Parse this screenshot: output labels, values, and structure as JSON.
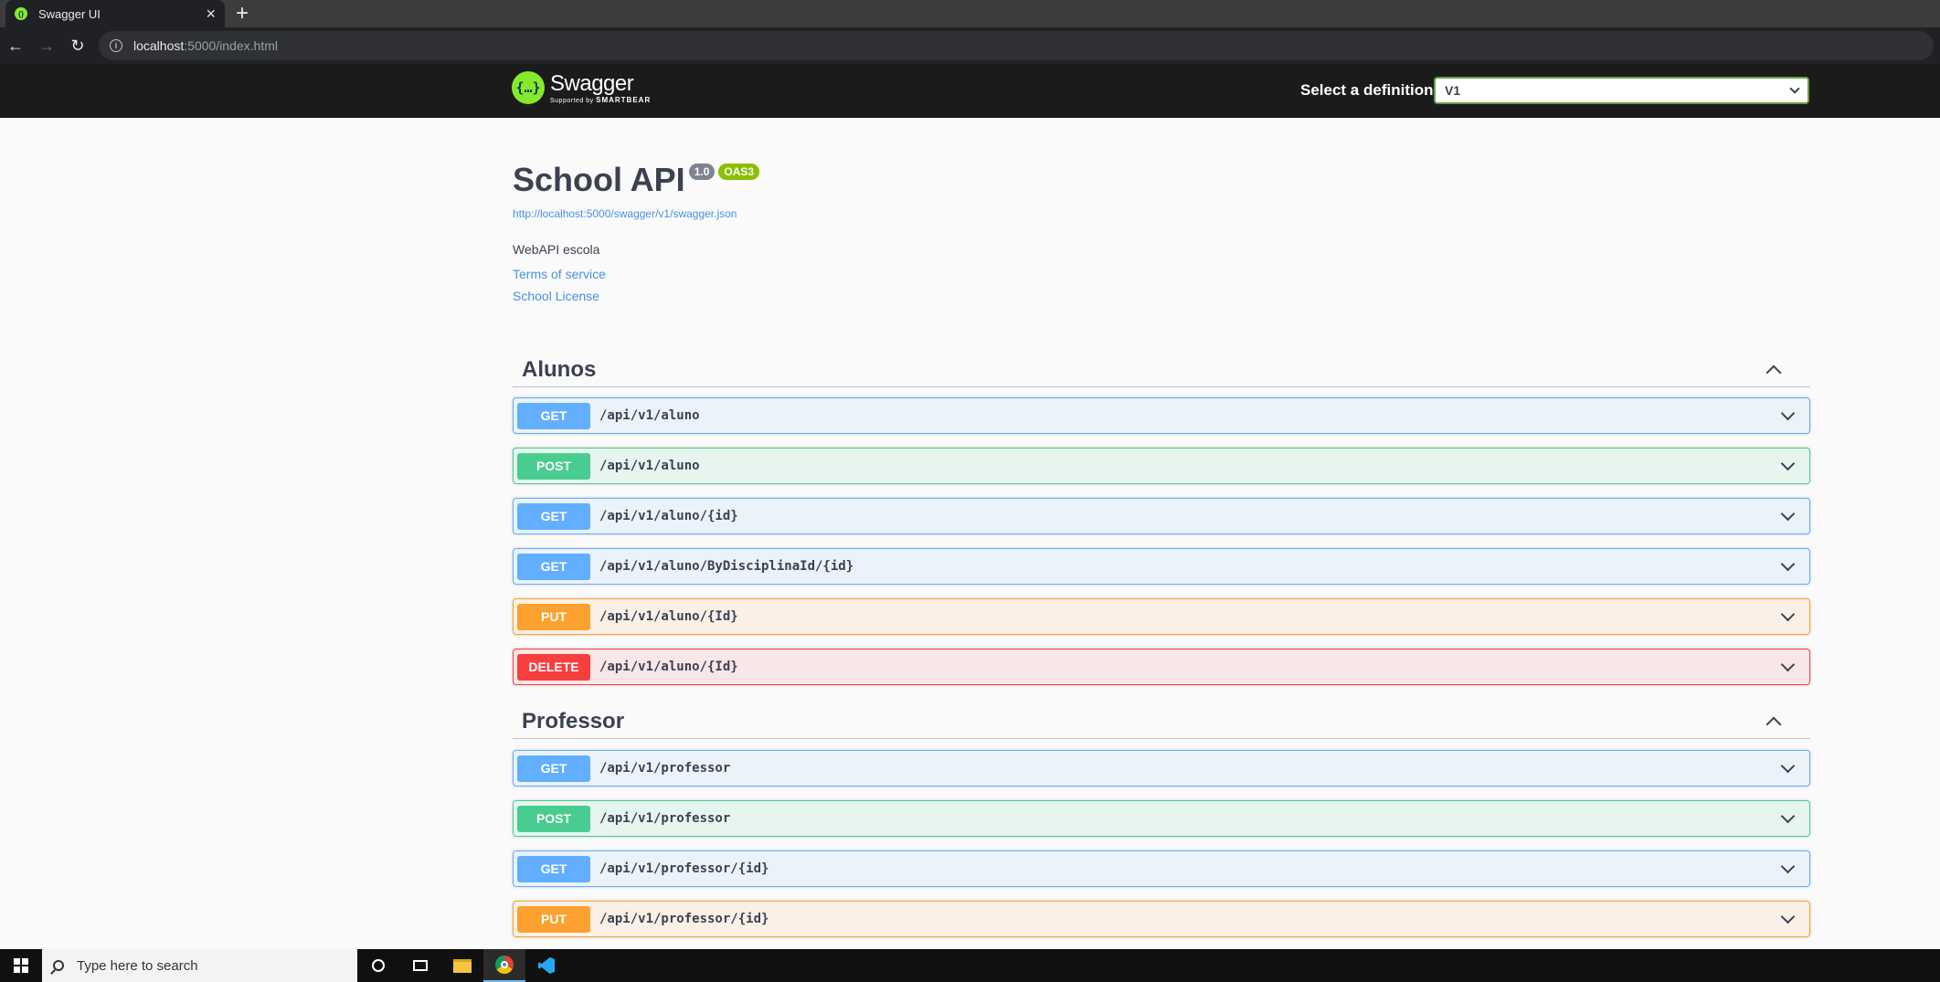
{
  "browser": {
    "tab_title": "Swagger UI",
    "new_tab": "+",
    "close_tab": "×",
    "url_host": "localhost",
    "url_path": ":5000/index.html"
  },
  "topbar": {
    "logo_name": "Swagger",
    "logo_supported": "Supported by",
    "logo_brand": "SMARTBEAR",
    "definition_label": "Select a definition",
    "definition_value": "V1"
  },
  "info": {
    "title": "School API",
    "version": "1.0",
    "oas": "OAS3",
    "spec_url": "http://localhost:5000/swagger/v1/swagger.json",
    "description": "WebAPI escola",
    "terms": "Terms of service",
    "license": "School License"
  },
  "tags": [
    {
      "name": "Alunos",
      "operations": [
        {
          "method": "GET",
          "path": "/api/v1/aluno"
        },
        {
          "method": "POST",
          "path": "/api/v1/aluno"
        },
        {
          "method": "GET",
          "path": "/api/v1/aluno/{id}"
        },
        {
          "method": "GET",
          "path": "/api/v1/aluno/ByDisciplinaId/{id}"
        },
        {
          "method": "PUT",
          "path": "/api/v1/aluno/{Id}"
        },
        {
          "method": "DELETE",
          "path": "/api/v1/aluno/{Id}"
        }
      ]
    },
    {
      "name": "Professor",
      "operations": [
        {
          "method": "GET",
          "path": "/api/v1/professor"
        },
        {
          "method": "POST",
          "path": "/api/v1/professor"
        },
        {
          "method": "GET",
          "path": "/api/v1/professor/{id}"
        },
        {
          "method": "PUT",
          "path": "/api/v1/professor/{id}"
        }
      ]
    }
  ],
  "taskbar": {
    "search_placeholder": "Type here to search"
  },
  "colors": {
    "get": "#61affe",
    "post": "#49cc90",
    "put": "#fca130",
    "delete": "#f93e3e",
    "topbar": "#1b1b1b",
    "link": "#4990e2"
  }
}
